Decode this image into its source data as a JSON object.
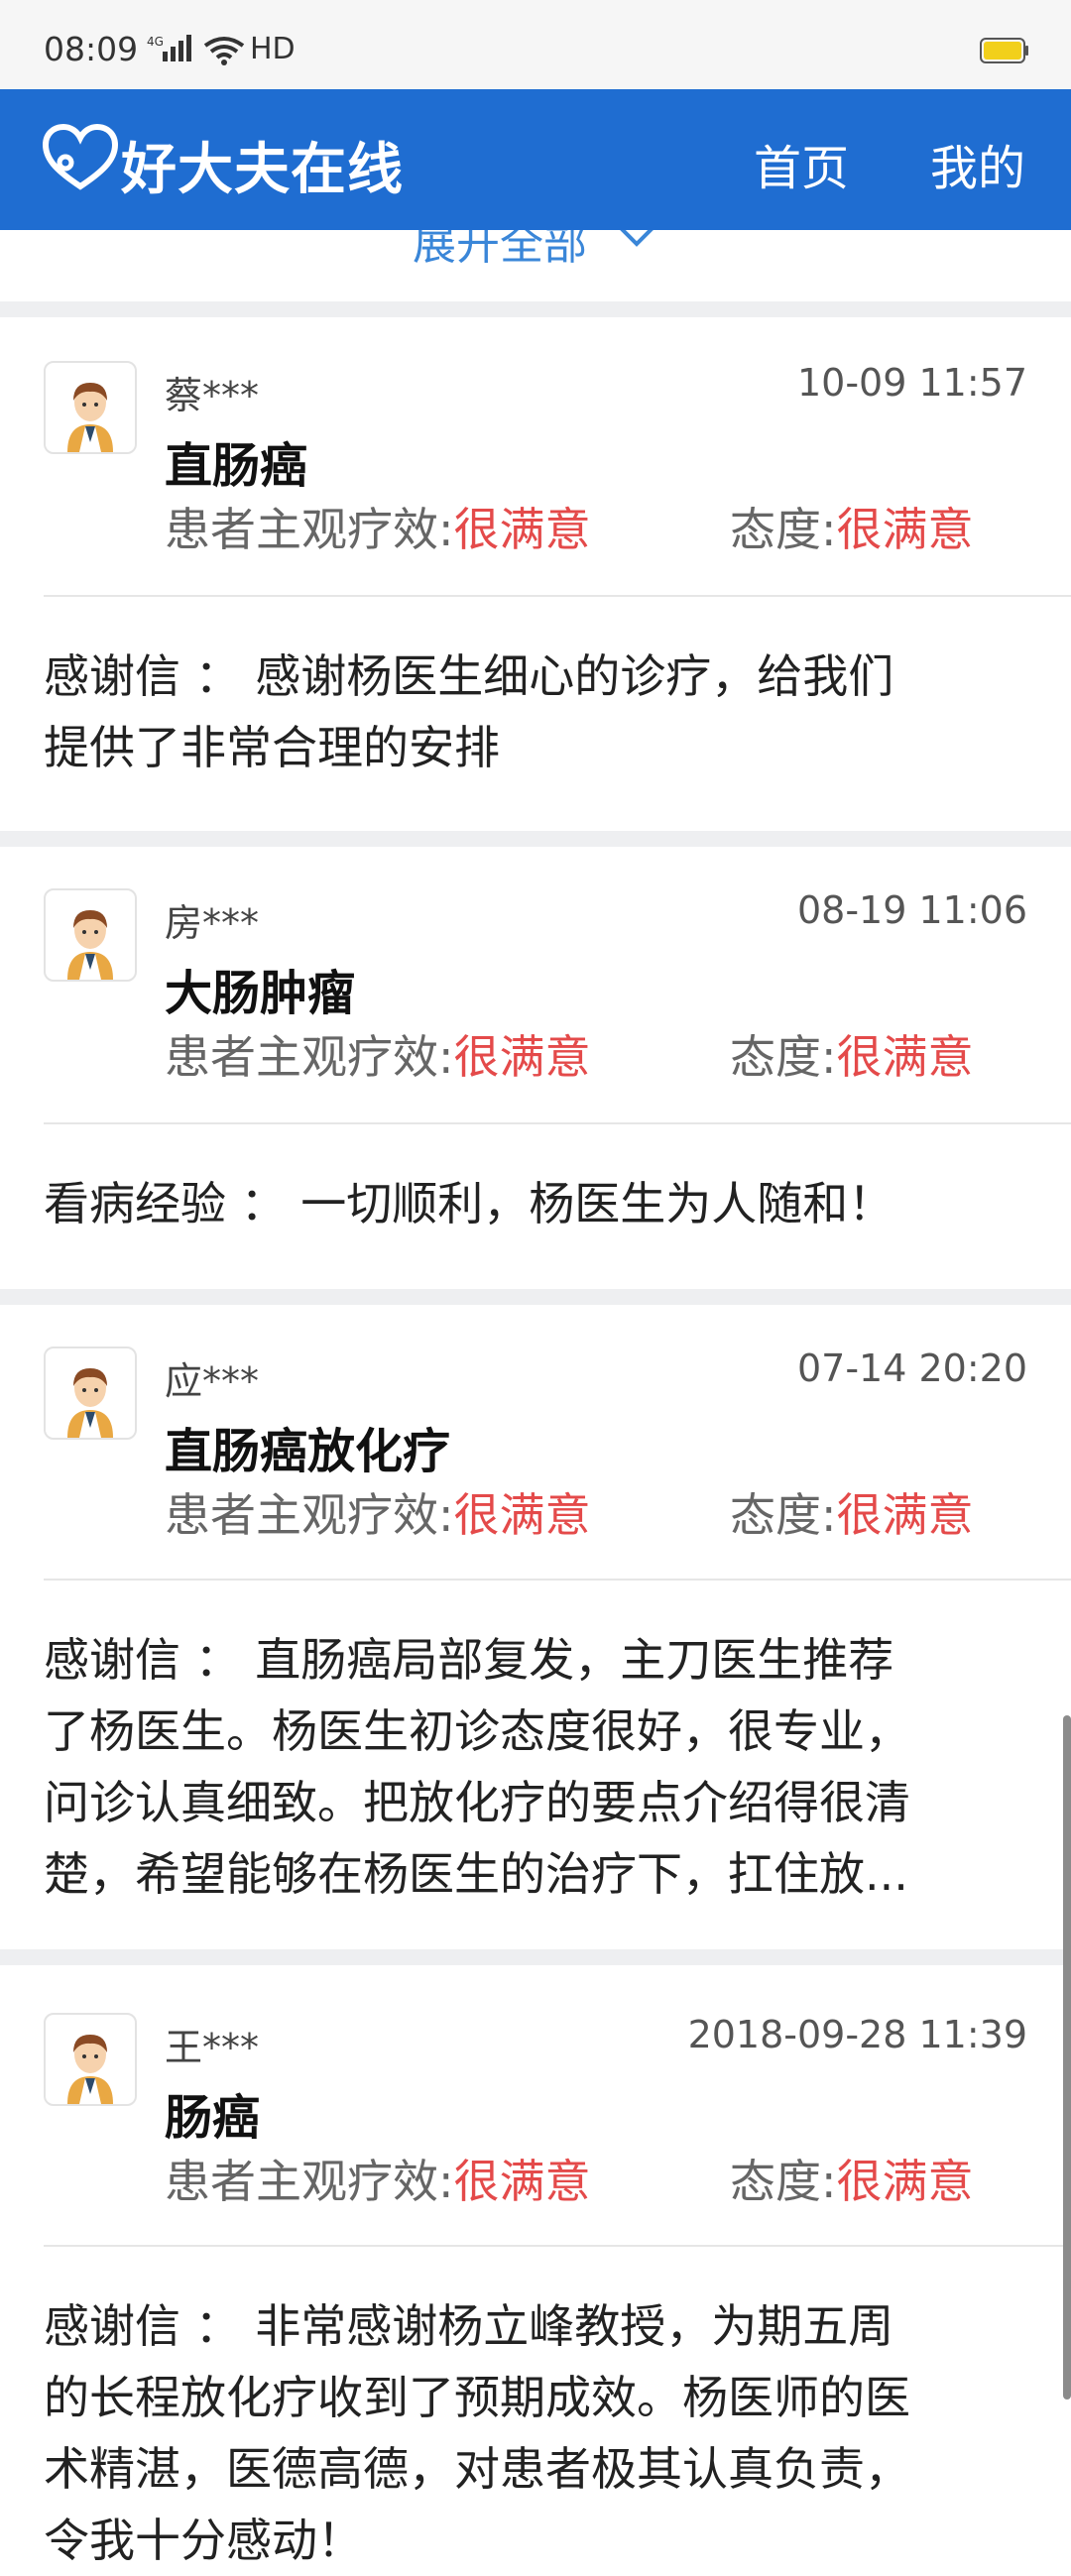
{
  "status_bar": {
    "time": "08:09",
    "network": "4G",
    "hd": "HD"
  },
  "header": {
    "logo_text": "好大夫在线",
    "nav": [
      "首页",
      "我的"
    ],
    "brand_color": "#1f6dd1"
  },
  "expand": {
    "label": "展开全部"
  },
  "labels": {
    "effect": "患者主观疗效:",
    "attitude": "态度:"
  },
  "reviews": [
    {
      "name": "蔡***",
      "time": "10-09 11:57",
      "disease": "直肠癌",
      "effect_value": "很满意",
      "attitude_value": "很满意",
      "content_lines": [
        "感谢信 ： 感谢杨医生细心的诊疗，给我们",
        "提供了非常合理的安排"
      ]
    },
    {
      "name": "房***",
      "time": "08-19 11:06",
      "disease": "大肠肿瘤",
      "effect_value": "很满意",
      "attitude_value": "很满意",
      "content_lines": [
        "看病经验 ： 一切顺利，杨医生为人随和！"
      ]
    },
    {
      "name": "应***",
      "time": "07-14 20:20",
      "disease": "直肠癌放化疗",
      "effect_value": "很满意",
      "attitude_value": "很满意",
      "content_lines": [
        "感谢信 ： 直肠癌局部复发，主刀医生推荐",
        "了杨医生。杨医生初诊态度很好，很专业，",
        "问诊认真细致。把放化疗的要点介绍得很清",
        "楚，希望能够在杨医生的治疗下，扛住放..."
      ]
    },
    {
      "name": "王***",
      "time": "2018-09-28 11:39",
      "disease": "肠癌",
      "effect_value": "很满意",
      "attitude_value": "很满意",
      "content_lines": [
        "感谢信 ： 非常感谢杨立峰教授，为期五周",
        "的长程放化疗收到了预期成效。杨医师的医",
        "术精湛，医德高德，对患者极其认真负责，",
        "令我十分感动！"
      ]
    }
  ]
}
